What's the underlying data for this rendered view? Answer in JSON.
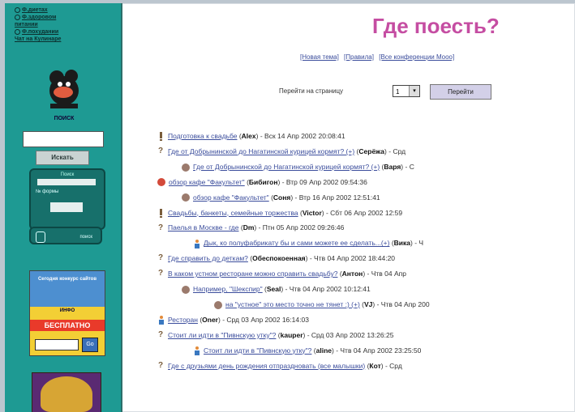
{
  "sidebar": {
    "links": [
      "Ф.диетах",
      "Ф.здоровом",
      "питании",
      "Ф.похудании",
      "Чат на Кулинаре"
    ],
    "logo_caption": "ПОИСК",
    "search_button": "Искать",
    "form_label_top": "Поиск",
    "form_label_mid": "№ формы",
    "search_label": "поиск",
    "ad_top_text": "Сегодня конкурс сайтов",
    "ad_mid_text": "ИНФО",
    "ad_free": "БЕСПЛАТНО",
    "ad_go": "Go"
  },
  "main": {
    "title": "Где поесть?",
    "top_links": [
      "[Новая тема]",
      "[Правила]",
      "[Все конференции Mooo]"
    ],
    "goto_label": "Перейти на страницу",
    "goto_value": "1",
    "goto_button": "Перейти"
  },
  "threads": [
    {
      "icon": "excl",
      "indent": 0,
      "title": "Подготовка к свадьбе",
      "author": "Alex",
      "date": "Вск 14 Апр 2002 20:08:41"
    },
    {
      "icon": "q",
      "indent": 0,
      "title": "Где от Добрынинской до Нагатинской курицей кормят? (+)",
      "author": "Серёжа",
      "date": "Срд"
    },
    {
      "icon": "bulb",
      "indent": 1,
      "title": "Где от Добрынинской до Нагатинской курицей кормят? (+)",
      "author": "Варя",
      "date": "С"
    },
    {
      "icon": "red",
      "indent": 0,
      "title": "обзор кафе \"Факультет\"",
      "author": "Бибигон",
      "date": "Втр 09 Апр 2002 09:54:36"
    },
    {
      "icon": "bulb",
      "indent": 1,
      "title": "обзор кафе \"Факультет\"",
      "author": "Соня",
      "date": "Втр 16 Апр 2002 12:51:41"
    },
    {
      "icon": "excl",
      "indent": 0,
      "title": "Свадьбы, банкеты, семейные торжества",
      "author": "Victor",
      "date": "Сбт 06 Апр 2002 12:59"
    },
    {
      "icon": "q",
      "indent": 0,
      "title": "Паелья в Москве - где",
      "author": "Dm",
      "date": "Птн 05 Апр 2002 09:26:46"
    },
    {
      "icon": "fig",
      "indent": 2,
      "title": "Дык, ко полуфабрикату бы и сами можете ее сделать...(+)",
      "author": "Вика",
      "date": "Ч"
    },
    {
      "icon": "q",
      "indent": 0,
      "title": "Где справить до деткам?",
      "author": "Обеспокоенная",
      "date": "Чтв 04 Апр 2002 18:44:20"
    },
    {
      "icon": "q",
      "indent": 0,
      "title": "В каком устном ресторане можно справить свадьбу?",
      "author": "Антон",
      "date": "Чтв 04 Апр"
    },
    {
      "icon": "bulb",
      "indent": 1,
      "title": "Например, \"Шекспир\"",
      "author": "Seal",
      "date": "Чтв 04 Апр 2002 10:12:41"
    },
    {
      "icon": "bulb",
      "indent": 3,
      "title": "на \"устное\" это место точно не тянет :) (+)",
      "author": "VJ",
      "date": "Чтв 04 Апр 200"
    },
    {
      "icon": "fig",
      "indent": 0,
      "title": "Ресторан",
      "author": "Oner",
      "date": "Срд 03 Апр 2002 16:14:03"
    },
    {
      "icon": "q",
      "indent": 0,
      "title": "Стоит ли идти в \"Пивнскую утку\"?",
      "author": "kauper",
      "date": "Срд 03 Апр 2002 13:26:25"
    },
    {
      "icon": "fig",
      "indent": 2,
      "title": "Стоит ли идти в \"Пивнскую утку\"?",
      "author": "aline",
      "date": "Чтв 04 Апр 2002 23:25:50"
    },
    {
      "icon": "q",
      "indent": 0,
      "title": "Где с друзьями день рождения отпраздновать (все малышки)",
      "author": "Кот",
      "date": "Срд"
    }
  ]
}
